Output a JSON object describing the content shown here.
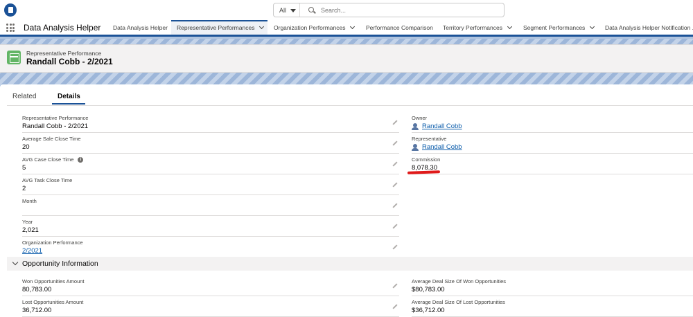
{
  "topbar": {
    "search_scope": "All",
    "search_placeholder": "Search..."
  },
  "nav": {
    "app_name": "Data Analysis Helper",
    "tabs": [
      {
        "label": "Data Analysis Helper",
        "dropdown": false
      },
      {
        "label": "Representative Performances",
        "dropdown": true,
        "active": true
      },
      {
        "label": "Organization Performances",
        "dropdown": true
      },
      {
        "label": "Performance Comparison",
        "dropdown": false
      },
      {
        "label": "Territory Performances",
        "dropdown": true
      },
      {
        "label": "Segment Performances",
        "dropdown": true
      },
      {
        "label": "Data Analysis Helper Notification ...",
        "dropdown": false
      }
    ]
  },
  "record": {
    "type_label": "Representative Performance",
    "title": "Randall Cobb - 2/2021"
  },
  "record_tabs": {
    "related": "Related",
    "details": "Details"
  },
  "details_left": [
    {
      "label": "Representative Performance",
      "value": "Randall Cobb - 2/2021"
    },
    {
      "label": "Average Sale Close Time",
      "value": "20"
    },
    {
      "label": "AVG Case Close Time",
      "value": "5"
    },
    {
      "label": "AVG Task Close Time",
      "value": "2"
    },
    {
      "label": "Month",
      "value": ""
    },
    {
      "label": "Year",
      "value": "2,021"
    },
    {
      "label": "Organization Performance",
      "value": "2/2021"
    }
  ],
  "details_right": [
    {
      "label": "Owner",
      "value": "Randall Cobb"
    },
    {
      "label": "Representative",
      "value": "Randall Cobb"
    },
    {
      "label": "Commission",
      "value": "8,078.30"
    }
  ],
  "opportunity_section": {
    "title": "Opportunity Information",
    "left": [
      {
        "label": "Won Opportunities Amount",
        "value": "80,783.00"
      },
      {
        "label": "Lost Opportunities Amount",
        "value": "36,712.00"
      }
    ],
    "right": [
      {
        "label": "Average Deal Size Of Won Opportunities",
        "value": "$80,783.00"
      },
      {
        "label": "Average Deal Size Of Lost Opportunities",
        "value": "$36,712.00"
      }
    ]
  },
  "colors": {
    "brand": "#1b5297",
    "link": "#0b5cab",
    "record_icon": "#62b565",
    "annotation_red": "#e01a1a"
  }
}
